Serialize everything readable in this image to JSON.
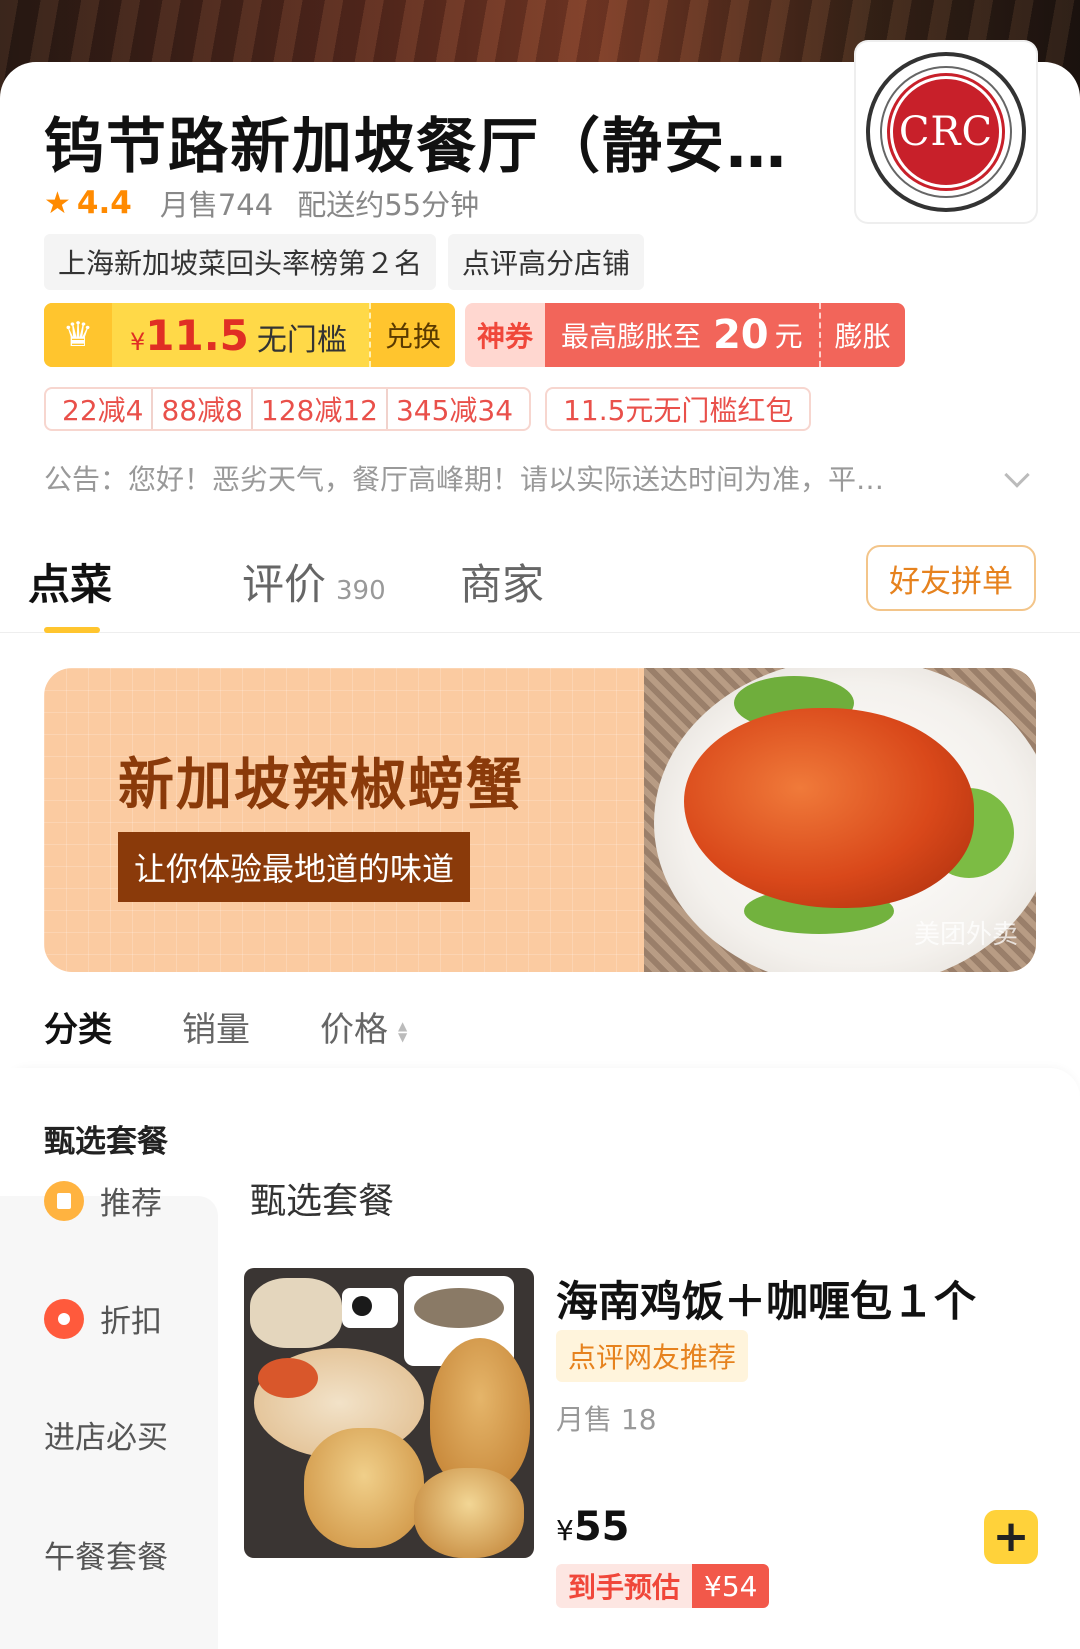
{
  "restaurant": {
    "name": "钨节路新加坡餐厅（静安…",
    "logo_text": "CRC",
    "rating": "4.4",
    "monthly_sales": "月售744",
    "delivery_time": "配送约55分钟",
    "tags": [
      "上海新加坡菜回头率榜第２名",
      "点评高分店铺"
    ]
  },
  "promos": {
    "vip": {
      "symbol": "¥",
      "amount": "11.5",
      "text": "无门槛",
      "action": "兑换"
    },
    "shen": {
      "label": "神券",
      "prefix": "最高膨胀至",
      "amount": "20",
      "suffix": "元",
      "action": "膨胀"
    },
    "discounts": [
      "22减4",
      "88减8",
      "128减12",
      "345减34"
    ],
    "red_packet": "11.5元无门槛红包"
  },
  "notice": "公告：您好！恶劣天气，餐厅高峰期！请以实际送达时间为准，平…",
  "tabs": {
    "order": "点菜",
    "reviews": "评价",
    "reviews_count": "390",
    "merchant": "商家",
    "group_order": "好友拼单"
  },
  "banner": {
    "title": "新加坡辣椒螃蟹",
    "subtitle": "让你体验最地道的味道",
    "watermark": "美团外卖"
  },
  "sort": {
    "category": "分类",
    "sales": "销量",
    "price": "价格"
  },
  "sidebar": {
    "active": "甄选套餐",
    "items": [
      "推荐",
      "折扣",
      "进店必买",
      "午餐套餐"
    ]
  },
  "menu": {
    "section_title": "甄选套餐",
    "dish": {
      "name": "海南鸡饭＋咖喱包１个",
      "badge": "点评网友推荐",
      "sales": "月售 18",
      "price_symbol": "¥",
      "price": "55",
      "estimate_label": "到手预估",
      "estimate_value": "¥54"
    }
  },
  "colors": {
    "accent_yellow": "#ffd23a",
    "brand_orange": "#ff8a00",
    "promo_red": "#f2655a"
  }
}
